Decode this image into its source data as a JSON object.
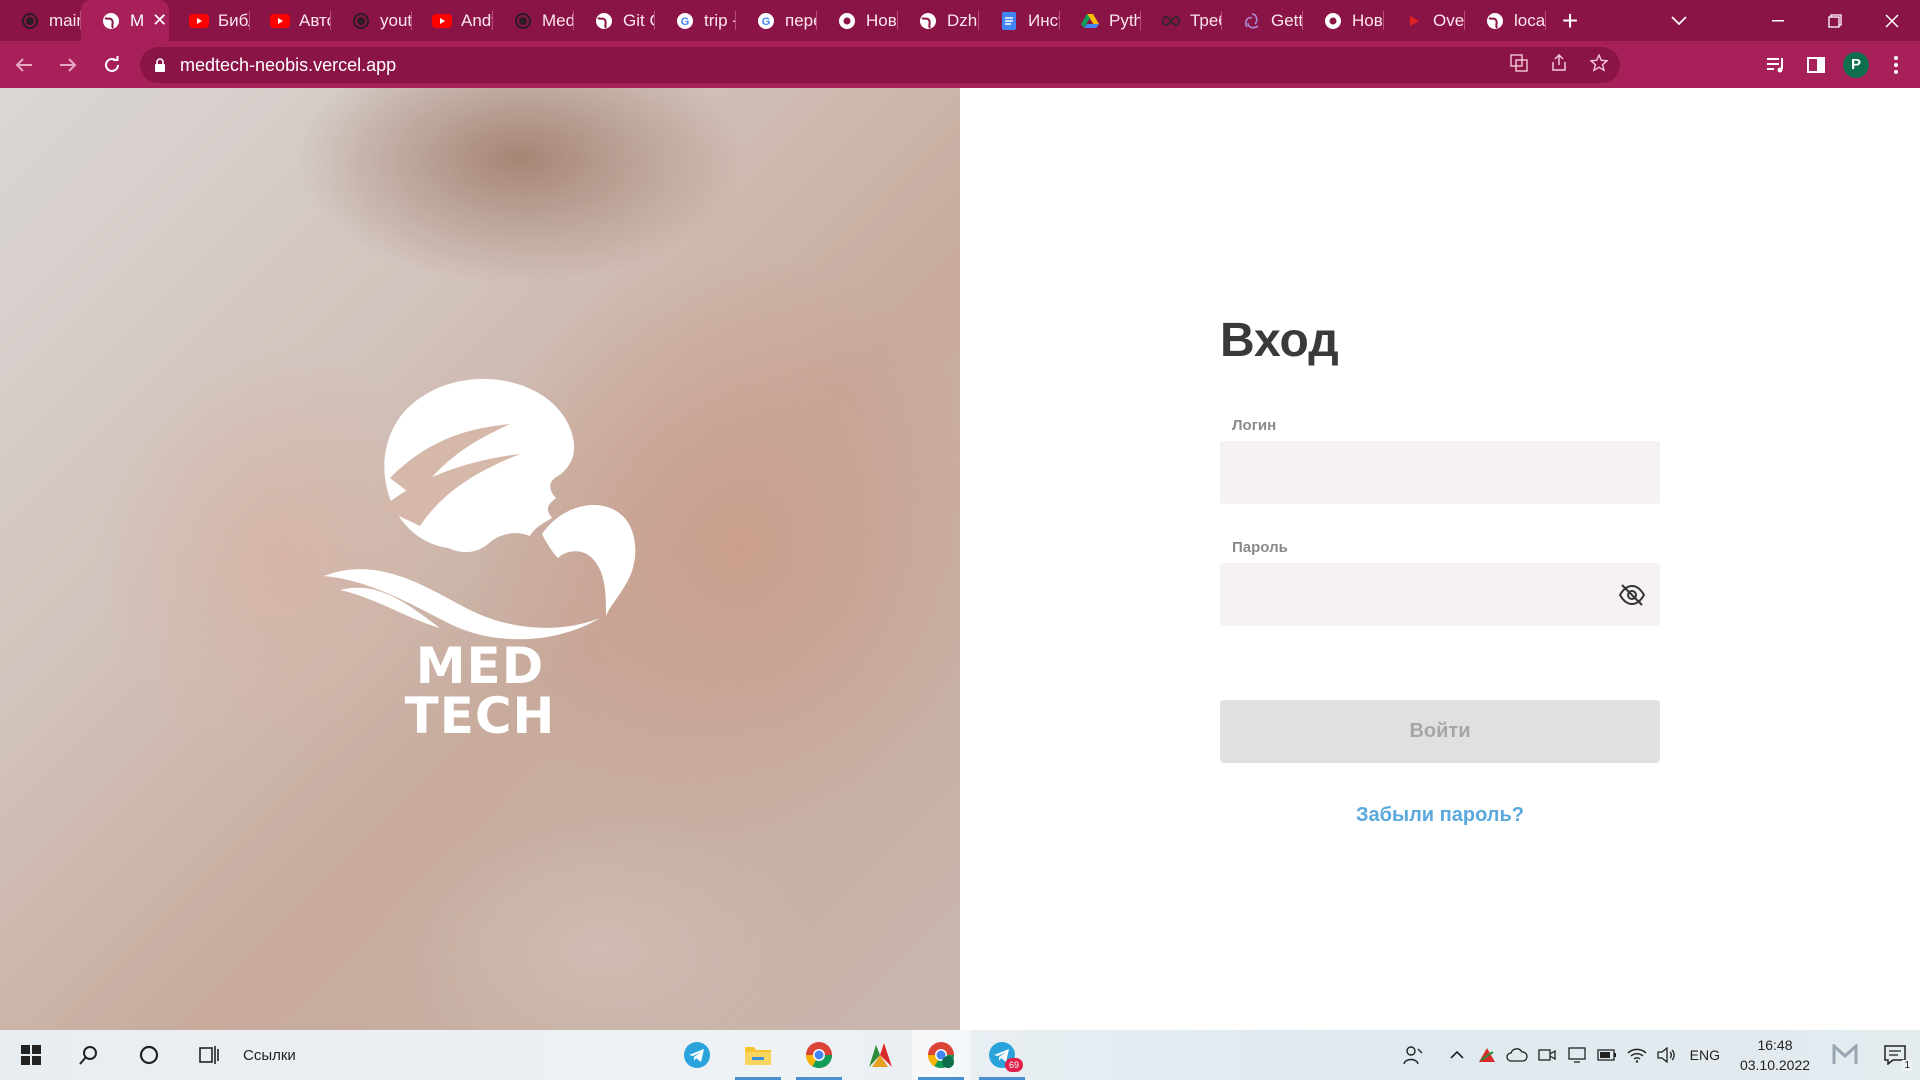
{
  "browser": {
    "tabs": [
      {
        "title": "main",
        "icon": "github-icon"
      },
      {
        "title": "M",
        "icon": "globe-icon",
        "active": true
      },
      {
        "title": "Библ",
        "icon": "youtube-icon"
      },
      {
        "title": "Авто",
        "icon": "youtube-icon"
      },
      {
        "title": "youtu",
        "icon": "github-icon"
      },
      {
        "title": "Andy",
        "icon": "youtube-icon"
      },
      {
        "title": "Med",
        "icon": "github-icon"
      },
      {
        "title": "Git C",
        "icon": "globe-icon"
      },
      {
        "title": "trip -",
        "icon": "google-icon"
      },
      {
        "title": "пере",
        "icon": "google-icon"
      },
      {
        "title": "Нова",
        "icon": "chrome-icon"
      },
      {
        "title": "Dzha",
        "icon": "globe-icon"
      },
      {
        "title": "Инст",
        "icon": "docs-icon"
      },
      {
        "title": "Pyth",
        "icon": "drive-icon"
      },
      {
        "title": "Треб",
        "icon": "infinity-icon"
      },
      {
        "title": "Getti",
        "icon": "redux-icon"
      },
      {
        "title": "Нова",
        "icon": "chrome-icon"
      },
      {
        "title": "Over",
        "icon": "play-icon"
      },
      {
        "title": "local",
        "icon": "globe-icon"
      }
    ],
    "url": "medtech-neobis.vercel.app",
    "profile_initial": "P",
    "colors": {
      "frame": "#8b1446",
      "toolbar": "#a8205a"
    }
  },
  "hero": {
    "logo_line1": "MED",
    "logo_line2": "TECH"
  },
  "login": {
    "title": "Вход",
    "login_label": "Логин",
    "login_value": "",
    "password_label": "Пароль",
    "password_value": "",
    "submit_label": "Войти",
    "forgot_label": "Забыли пароль?",
    "colors": {
      "link": "#5aa8dc",
      "field_bg": "#f5f1f4",
      "button_disabled": "#e0e0e0"
    }
  },
  "taskbar": {
    "links_label": "Ссылки",
    "apps": [
      "telegram-icon",
      "file-explorer-icon",
      "chrome-icon",
      "app-icon",
      "chrome-profile-icon",
      "telegram-icon"
    ],
    "telegram_badge": "69",
    "language": "ENG",
    "time": "16:48",
    "date": "03.10.2022",
    "notifications": "1"
  }
}
